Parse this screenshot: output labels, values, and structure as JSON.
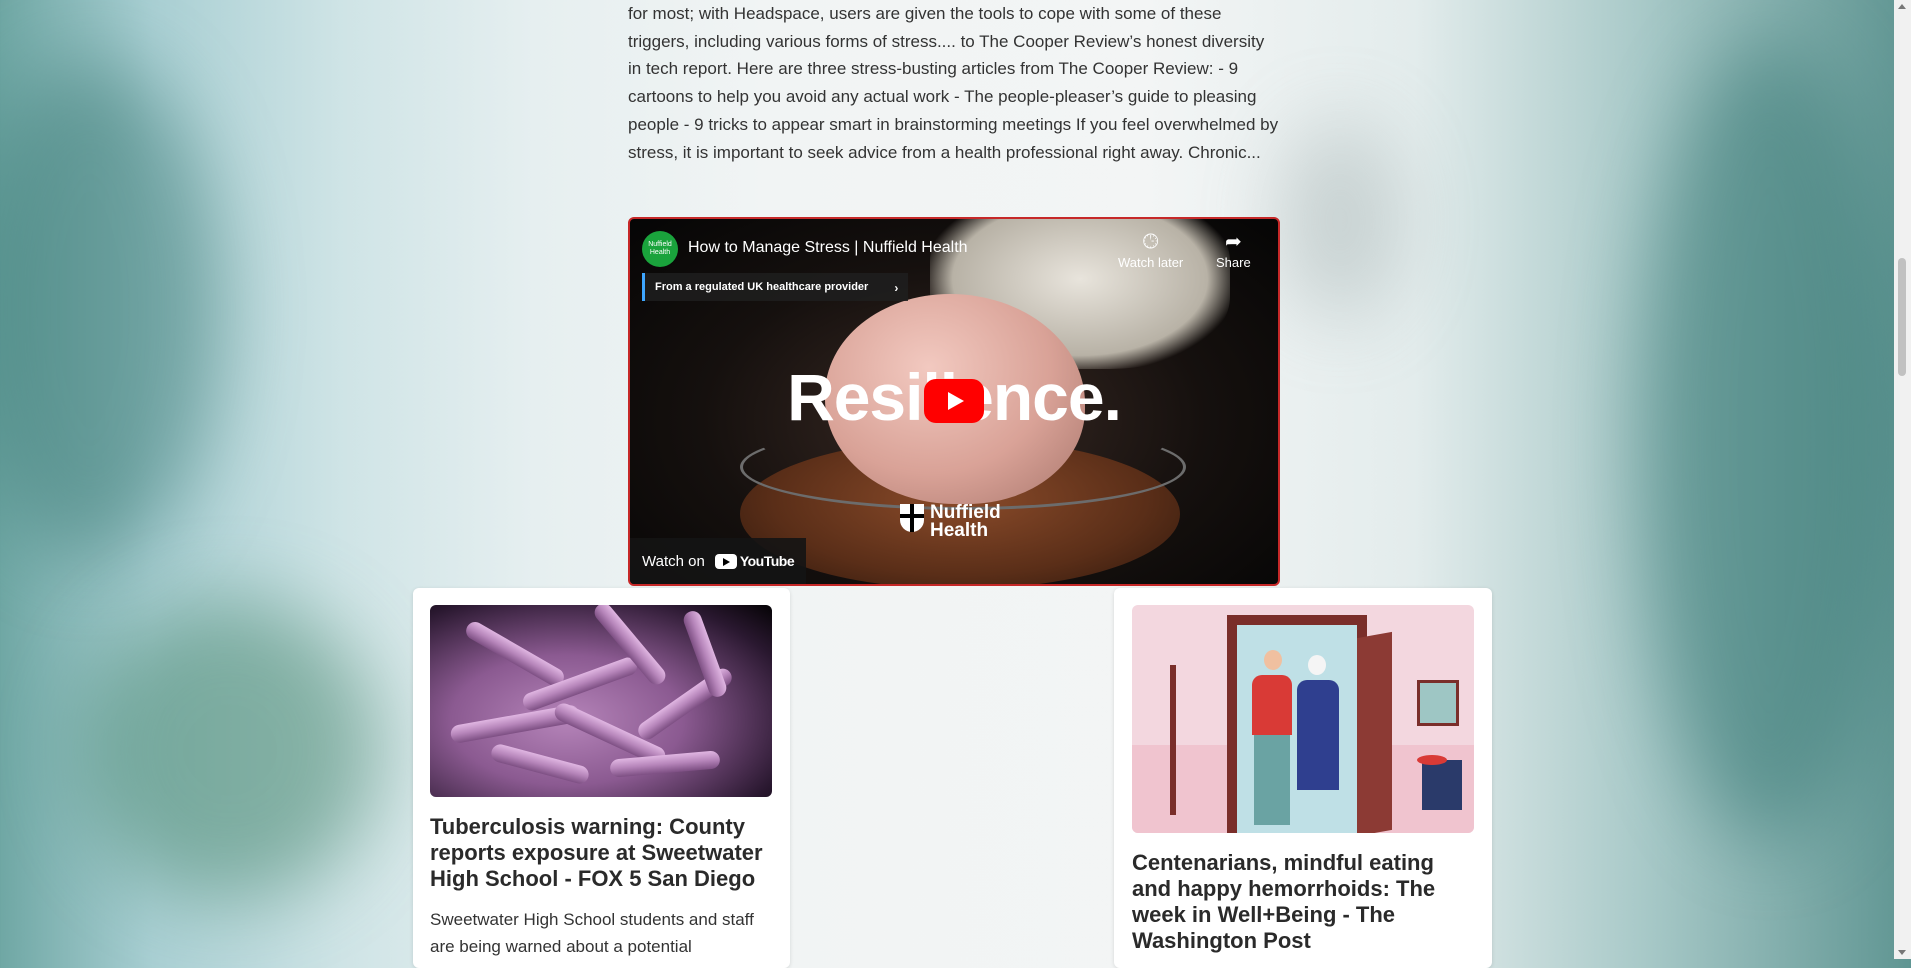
{
  "article": {
    "text": "for most; with Headspace, users are given the tools to cope with some of these triggers, including various forms of stress.... to The Cooper Review’s honest diversity in tech report. Here are three stress-busting articles from The Cooper Review: - 9 cartoons to help you avoid any actual work - The people-pleaser’s guide to pleasing people - 9 tricks to appear smart in brainstorming meetings If you feel overwhelmed by stress, it is important to seek advice from a health professional right away. Chronic..."
  },
  "video": {
    "title": "How to Manage Stress | Nuffield Health",
    "channel_avatar_text": "Nuffield Health",
    "badge": "From a regulated UK healthcare provider",
    "watch_later": "Watch later",
    "share": "Share",
    "overlay_word": "Resilience.",
    "logo_text": "Nuffield Health",
    "watch_on": "Watch on",
    "youtube": "YouTube"
  },
  "cards": [
    {
      "title": "Tuberculosis warning: County reports exposure at Sweetwater High School - FOX 5 San Diego",
      "desc": "Sweetwater High School students and staff are being warned about a potential"
    },
    {
      "title": "Centenarians, mindful eating and happy hemorrhoids: The week in Well+Being - The Washington Post"
    }
  ]
}
